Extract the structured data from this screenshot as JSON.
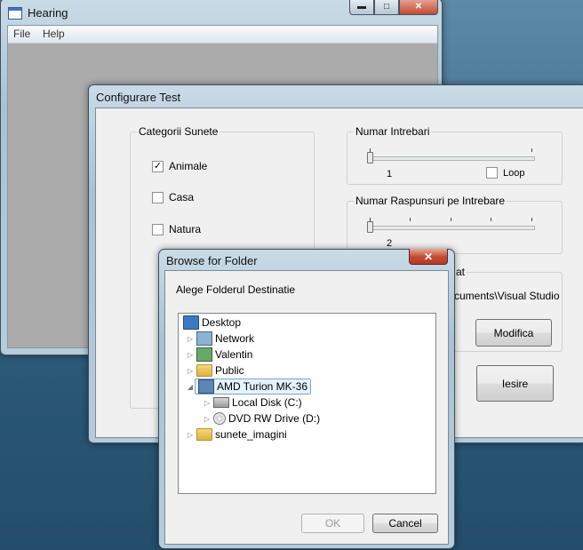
{
  "hearing": {
    "title": "Hearing",
    "menu": [
      "File",
      "Help"
    ],
    "caption_buttons": {
      "minimize": "▬",
      "maximize": "□",
      "close": "✕"
    }
  },
  "config": {
    "title": "Configurare Test",
    "categories": {
      "label": "Categorii Sunete",
      "items": [
        {
          "label": "Animale",
          "checked": true
        },
        {
          "label": "Casa",
          "checked": false
        },
        {
          "label": "Natura",
          "checked": false
        }
      ]
    },
    "questions": {
      "label": "Numar Intrebari",
      "value": "1",
      "loop_label": "Loop",
      "loop_checked": false
    },
    "answers": {
      "label": "Numar Raspunsuri pe Intrebare",
      "value": "2"
    },
    "folder": {
      "label_fragment": "at",
      "path_fragment": "cuments\\Visual Studio",
      "modify_label": "Modifica"
    },
    "exit_label": "Iesire"
  },
  "browse": {
    "title": "Browse for Folder",
    "close_glyph": "✕",
    "instruction": "Alege Folderul Destinatie",
    "tree": [
      {
        "label": "Desktop",
        "icon": "desktop-icon",
        "level": 0,
        "arrow": ""
      },
      {
        "label": "Network",
        "icon": "network-icon",
        "level": 1,
        "arrow": "▷"
      },
      {
        "label": "Valentin",
        "icon": "user-folder-icon",
        "level": 1,
        "arrow": "▷"
      },
      {
        "label": "Public",
        "icon": "folder-icon",
        "level": 1,
        "arrow": "▷"
      },
      {
        "label": "AMD Turion MK-36",
        "icon": "computer-icon",
        "level": 1,
        "arrow": "◢",
        "selected": true
      },
      {
        "label": "Local Disk (C:)",
        "icon": "hard-disk-icon",
        "level": 2,
        "arrow": "▷"
      },
      {
        "label": "DVD RW Drive (D:)",
        "icon": "dvd-drive-icon",
        "level": 2,
        "arrow": "▷"
      },
      {
        "label": "sunete_imagini",
        "icon": "folder-icon",
        "level": 1,
        "arrow": "▷"
      }
    ],
    "ok_label": "OK",
    "cancel_label": "Cancel"
  }
}
